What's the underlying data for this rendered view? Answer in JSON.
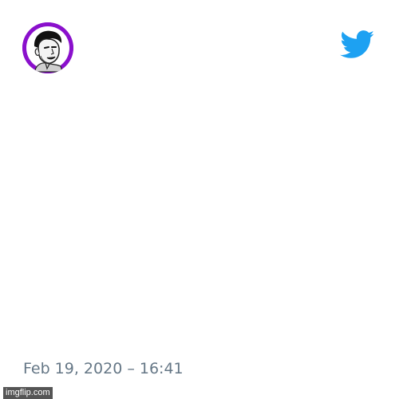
{
  "tweet": {
    "timestamp": "Feb 19, 2020 – 16:41",
    "avatar_icon": "profile-photo-icon",
    "platform_icon": "twitter-bird-icon",
    "platform_color": "#1da1f2",
    "avatar_ring_color": "#8a10cc"
  },
  "watermark": {
    "text": "imgflip.com"
  }
}
